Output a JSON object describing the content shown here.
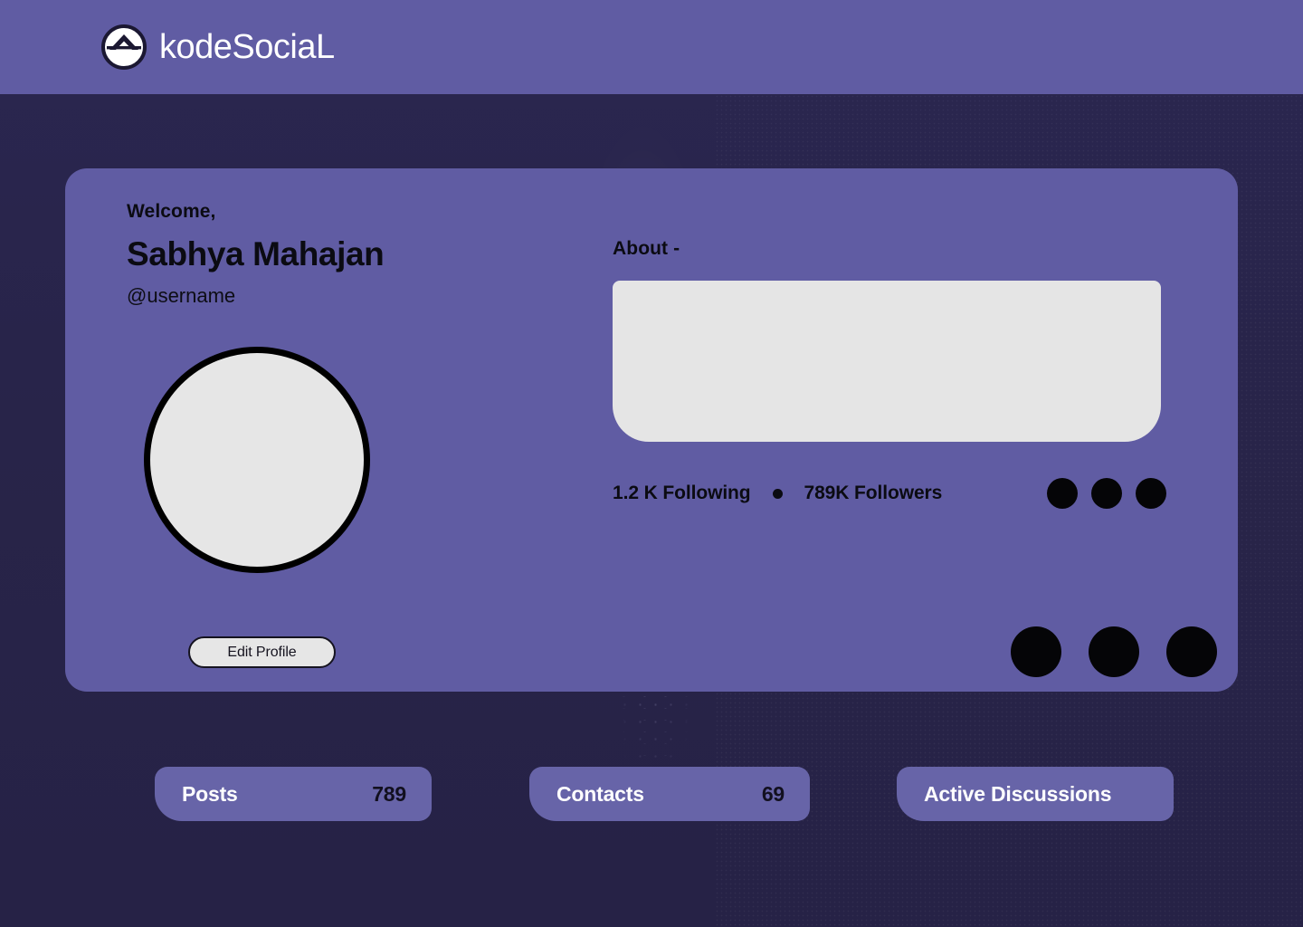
{
  "brand": {
    "name": "kodeSociaL",
    "logo_icon": "chevron-in-circle-logo-icon"
  },
  "theme": {
    "page_background": "#262246",
    "card_purple": "#605CA3",
    "pill_purple": "#6764A8",
    "placeholder_gray": "#e5e5e5",
    "ink": "#0b0b12",
    "white": "#ffffff"
  },
  "profile": {
    "welcome_label": "Welcome,",
    "name": "Sabhya Mahajan",
    "handle": "@username",
    "avatar_alt": "avatar-placeholder",
    "edit_profile_label": "Edit Profile"
  },
  "about": {
    "label": "About -",
    "body_text": ""
  },
  "social_stats": {
    "following": "1.2 K Following",
    "separator": "●",
    "followers": "789K Followers"
  },
  "action_dots": {
    "small": [
      "dot-1",
      "dot-2",
      "dot-3"
    ],
    "large": [
      "dot-1",
      "dot-2",
      "dot-3"
    ]
  },
  "bottom_stats": [
    {
      "label": "Posts",
      "value": "789"
    },
    {
      "label": "Contacts",
      "value": "69"
    },
    {
      "label": "Active Discussions",
      "value": ""
    }
  ]
}
